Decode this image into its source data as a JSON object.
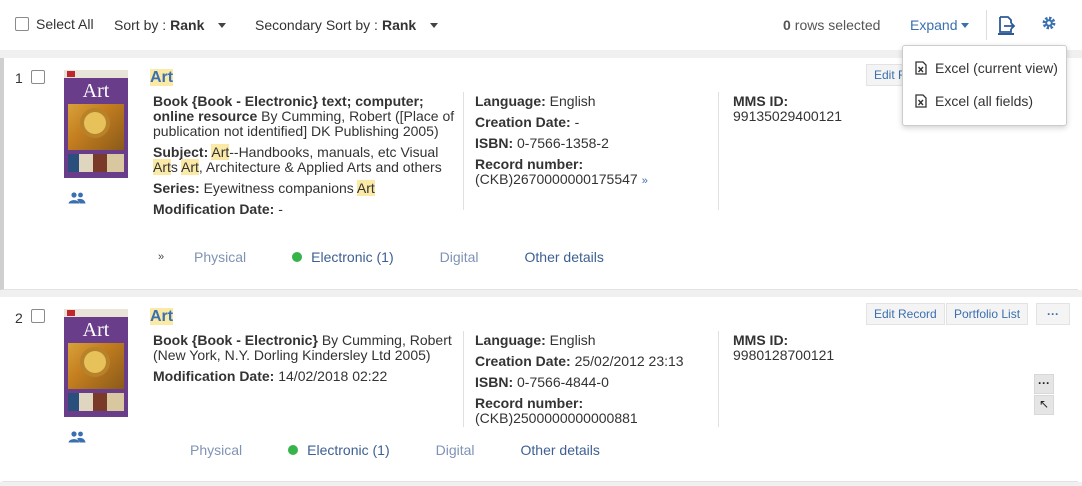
{
  "toolbar": {
    "select_all": "Select All",
    "sort_by_label": "Sort by :",
    "sort_by_value": "Rank",
    "secondary_sort_label": "Secondary Sort by :",
    "secondary_sort_value": "Rank",
    "rows_selected_count": "0",
    "rows_selected_text": "rows selected",
    "expand_label": "Expand"
  },
  "export_menu": {
    "items": [
      {
        "label": "Excel (current view)",
        "icon": "excel-file-icon"
      },
      {
        "label": "Excel (all fields)",
        "icon": "excel-file-icon"
      }
    ]
  },
  "records": [
    {
      "number": "1",
      "title": "Art",
      "cover_title": "Art",
      "type_bold": "Book {Book - Electronic} text; computer; online resource",
      "author_pub": "By Cumming, Robert ([Place of publication not identified] DK Publishing 2005)",
      "subject_label": "Subject:",
      "subject_a": "Art",
      "subject_b": "--Handbooks, manuals, etc Visual ",
      "subject_c": "Art",
      "subject_d": "s ",
      "subject_e": "Art",
      "subject_f": ", Architecture & Applied Arts and others",
      "series_label": "Series:",
      "series_text": "Eyewitness companions ",
      "series_hl": "Art",
      "modification_label": "Modification Date:",
      "modification_value": "-",
      "language_label": "Language:",
      "language_value": "English",
      "creation_label": "Creation Date:",
      "creation_value": "-",
      "isbn_label": "ISBN:",
      "isbn_value": "0-7566-1358-2",
      "record_number_label": "Record number:",
      "record_number_value": "(CKB)2670000000175547",
      "mms_label": "MMS ID:",
      "mms_value": "99135029400121",
      "edit_button": "Edit R",
      "tabs": {
        "physical": "Physical",
        "electronic": "Electronic (1)",
        "digital": "Digital",
        "other": "Other details"
      }
    },
    {
      "number": "2",
      "title": "Art",
      "cover_title": "Art",
      "type_bold": "Book {Book - Electronic}",
      "author_pub": "By Cumming, Robert (New York, N.Y. Dorling Kindersley Ltd 2005)",
      "modification_label": "Modification Date:",
      "modification_value": "14/02/2018 02:22",
      "language_label": "Language:",
      "language_value": "English",
      "creation_label": "Creation Date:",
      "creation_value": "25/02/2012 23:13",
      "isbn_label": "ISBN:",
      "isbn_value": "0-7566-4844-0",
      "record_number_label": "Record number:",
      "record_number_value": "(CKB)2500000000000881",
      "mms_label": "MMS ID:",
      "mms_value": "9980128700121",
      "edit_button": "Edit Record",
      "portfolio_button": "Portfolio List",
      "more_button": "···",
      "mini_more": "···",
      "mini_arrow": "↖",
      "tabs": {
        "physical": "Physical",
        "electronic": "Electronic (1)",
        "digital": "Digital",
        "other": "Other details"
      }
    }
  ],
  "colors": {
    "link": "#3a6fb0",
    "highlight": "#fbe9a6",
    "status_green": "#36b34a"
  }
}
